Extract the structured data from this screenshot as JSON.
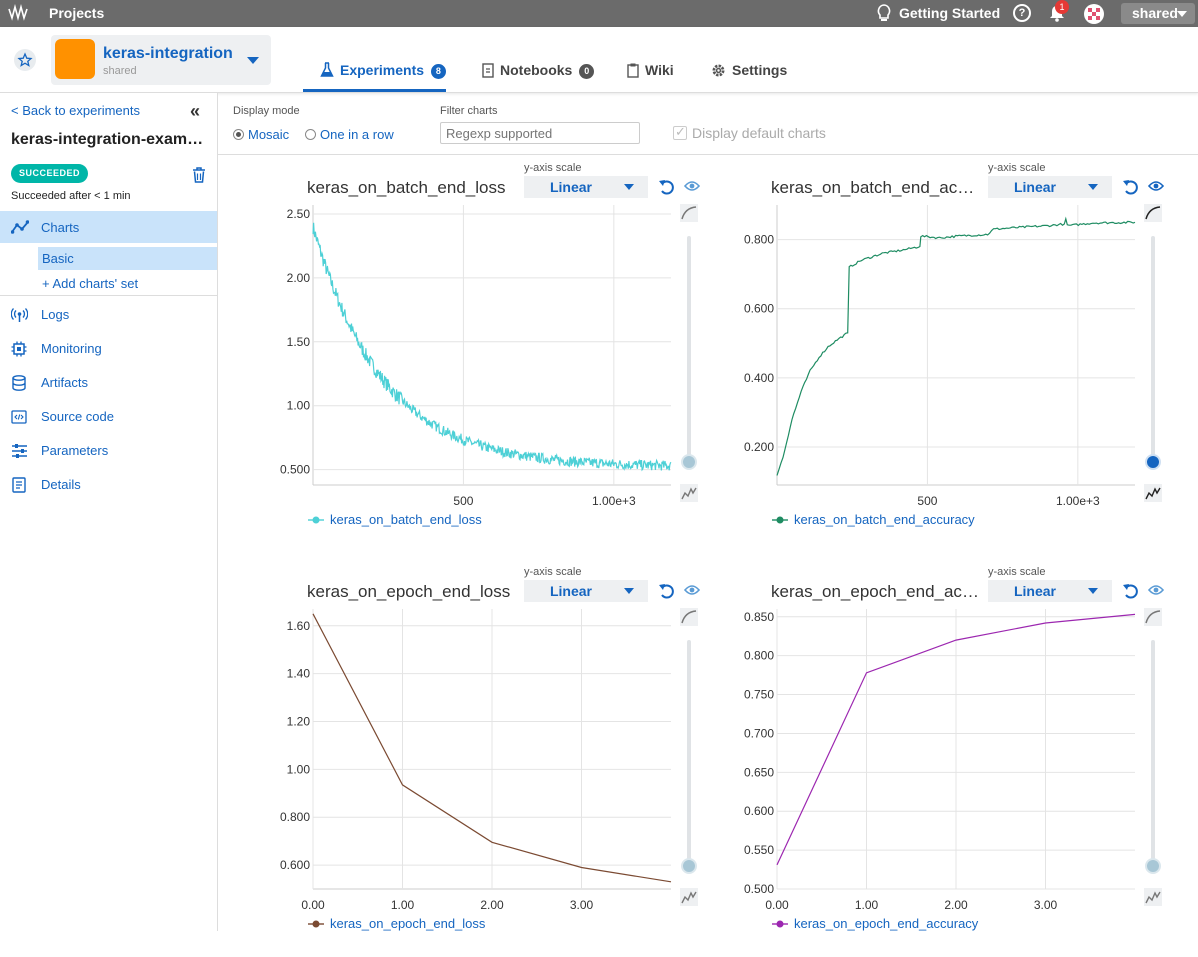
{
  "topbar": {
    "projects": "Projects",
    "getting_started": "Getting Started",
    "help": "?",
    "notifications": "1",
    "org": "shared"
  },
  "project": {
    "name": "keras-integration",
    "owner": "shared"
  },
  "tabs": [
    {
      "label": "Experiments",
      "count": "8",
      "active": true
    },
    {
      "label": "Notebooks",
      "count": "0"
    },
    {
      "label": "Wiki"
    },
    {
      "label": "Settings"
    }
  ],
  "sidebar": {
    "back": "< Back to experiments",
    "title": "keras-integration-exam…",
    "status": "SUCCEEDED",
    "duration": "Succeeded after < 1 min",
    "charts": "Charts",
    "basic": "Basic",
    "add": "+ Add charts' set",
    "items": [
      "Logs",
      "Monitoring",
      "Artifacts",
      "Source code",
      "Parameters",
      "Details"
    ]
  },
  "controls": {
    "display_mode": "Display mode",
    "mosaic": "Mosaic",
    "one_in_row": "One in a row",
    "filter_label": "Filter charts",
    "filter_placeholder": "Regexp supported",
    "default_charts": "Display default charts"
  },
  "colors": {
    "accent": "#1565c0",
    "batch_loss": "#4dd0d6",
    "batch_acc": "#1e8c62",
    "epoch_loss": "#7b4a32",
    "epoch_acc": "#9c27b0"
  },
  "chart_data": [
    {
      "type": "line",
      "title": "keras_on_batch_end_loss",
      "scale_label": "y-axis scale",
      "scale": "Linear",
      "yticks": [
        "2.50",
        "2.00",
        "1.50",
        "1.00",
        "0.500"
      ],
      "xticks": [
        "500",
        "1.00e+3"
      ],
      "xlim": [
        0,
        1190
      ],
      "ylim": [
        0.38,
        2.57
      ],
      "series": [
        {
          "name": "keras_on_batch_end_loss",
          "color": "#4dd0d6",
          "model": "loss_decay",
          "start": 2.4,
          "end": 0.52,
          "noise": 0.04
        }
      ],
      "y_values_at": {
        "0": 2.4,
        "100": 1.8,
        "200": 1.33,
        "300": 1.03,
        "400": 0.85,
        "500": 0.75,
        "600": 0.68,
        "700": 0.62,
        "800": 0.58,
        "900": 0.55,
        "1000": 0.53,
        "1190": 0.52
      }
    },
    {
      "type": "line",
      "title": "keras_on_batch_end_accuracy",
      "scale_label": "y-axis scale",
      "scale": "Linear",
      "yticks": [
        "0.800",
        "0.600",
        "0.400",
        "0.200"
      ],
      "xticks": [
        "500",
        "1.00e+3"
      ],
      "xlim": [
        0,
        1190
      ],
      "ylim": [
        0.09,
        0.9
      ],
      "series": [
        {
          "name": "keras_on_batch_end_accuracy",
          "color": "#1e8c62"
        }
      ],
      "points": [
        [
          0,
          0.12
        ],
        [
          20,
          0.17
        ],
        [
          50,
          0.28
        ],
        [
          80,
          0.36
        ],
        [
          110,
          0.42
        ],
        [
          140,
          0.46
        ],
        [
          170,
          0.49
        ],
        [
          200,
          0.51
        ],
        [
          235,
          0.53
        ],
        [
          240,
          0.72
        ],
        [
          280,
          0.74
        ],
        [
          350,
          0.76
        ],
        [
          420,
          0.77
        ],
        [
          475,
          0.78
        ],
        [
          478,
          0.81
        ],
        [
          540,
          0.805
        ],
        [
          600,
          0.81
        ],
        [
          700,
          0.815
        ],
        [
          720,
          0.83
        ],
        [
          800,
          0.835
        ],
        [
          900,
          0.84
        ],
        [
          955,
          0.845
        ],
        [
          960,
          0.86
        ],
        [
          965,
          0.84
        ],
        [
          1050,
          0.848
        ],
        [
          1190,
          0.85
        ]
      ]
    },
    {
      "type": "line",
      "title": "keras_on_epoch_end_loss",
      "scale_label": "y-axis scale",
      "scale": "Linear",
      "yticks": [
        "1.60",
        "1.40",
        "1.20",
        "1.00",
        "0.800",
        "0.600"
      ],
      "xticks": [
        "0.00",
        "1.00",
        "2.00",
        "3.00"
      ],
      "xlim": [
        0,
        4
      ],
      "ylim": [
        0.5,
        1.67
      ],
      "series": [
        {
          "name": "keras_on_epoch_end_loss",
          "color": "#7b4a32"
        }
      ],
      "points": [
        [
          0,
          1.65
        ],
        [
          1,
          0.935
        ],
        [
          2,
          0.695
        ],
        [
          3,
          0.59
        ],
        [
          4,
          0.53
        ]
      ]
    },
    {
      "type": "line",
      "title": "keras_on_epoch_end_accuracy",
      "scale_label": "y-axis scale",
      "scale": "Linear",
      "yticks": [
        "0.850",
        "0.800",
        "0.750",
        "0.700",
        "0.650",
        "0.600",
        "0.550",
        "0.500"
      ],
      "xticks": [
        "0.00",
        "1.00",
        "2.00",
        "3.00"
      ],
      "xlim": [
        0,
        4
      ],
      "ylim": [
        0.5,
        0.86
      ],
      "series": [
        {
          "name": "keras_on_epoch_end_accuracy",
          "color": "#9c27b0"
        }
      ],
      "points": [
        [
          0,
          0.531
        ],
        [
          1,
          0.778
        ],
        [
          2,
          0.82
        ],
        [
          3,
          0.842
        ],
        [
          4,
          0.853
        ]
      ]
    }
  ]
}
